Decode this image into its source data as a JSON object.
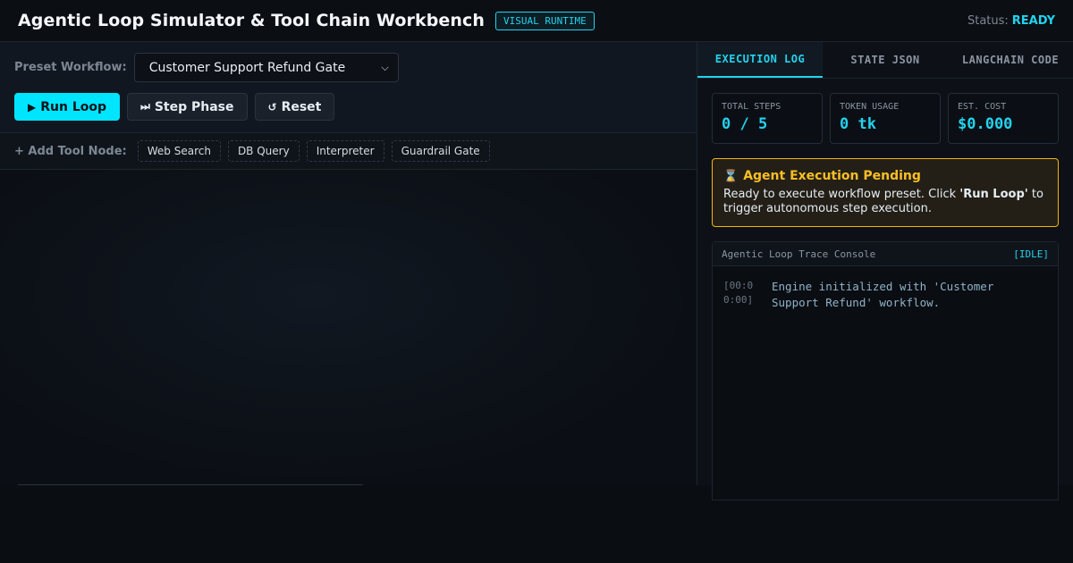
{
  "header": {
    "title": "Agentic Loop Simulator & Tool Chain Workbench",
    "badge": "VISUAL RUNTIME",
    "status_label": "Status:",
    "status_value": "READY"
  },
  "controls": {
    "preset_label": "Preset Workflow:",
    "preset_selected": "Customer Support Refund Gate",
    "run_label": "Run Loop",
    "step_label": "Step Phase",
    "reset_label": "Reset"
  },
  "toolbar": {
    "label": "+ Add Tool Node:",
    "tools": [
      "Web Search",
      "DB Query",
      "Interpreter",
      "Guardrail Gate"
    ]
  },
  "tabs": [
    "EXECUTION LOG",
    "STATE JSON",
    "LANGCHAIN CODE"
  ],
  "active_tab": 0,
  "metrics": [
    {
      "label": "TOTAL STEPS",
      "value": "0 / 5"
    },
    {
      "label": "TOKEN USAGE",
      "value": "0 tk"
    },
    {
      "label": "EST. COST",
      "value": "$0.000"
    }
  ],
  "alert": {
    "title": "Agent Execution Pending",
    "body_before": "Ready to execute workflow preset. Click ",
    "body_bold": "'Run Loop'",
    "body_after": " to trigger autonomous step execution."
  },
  "console": {
    "title": "Agentic Loop Trace Console",
    "state": "[IDLE]",
    "entries": [
      {
        "time": "[00:00:00]",
        "message": "Engine initialized with 'Customer Support Refund' workflow."
      }
    ]
  },
  "colors": {
    "accent": "#22d3ee",
    "primary_button": "#00e5ff",
    "warning": "#fbbf24"
  }
}
